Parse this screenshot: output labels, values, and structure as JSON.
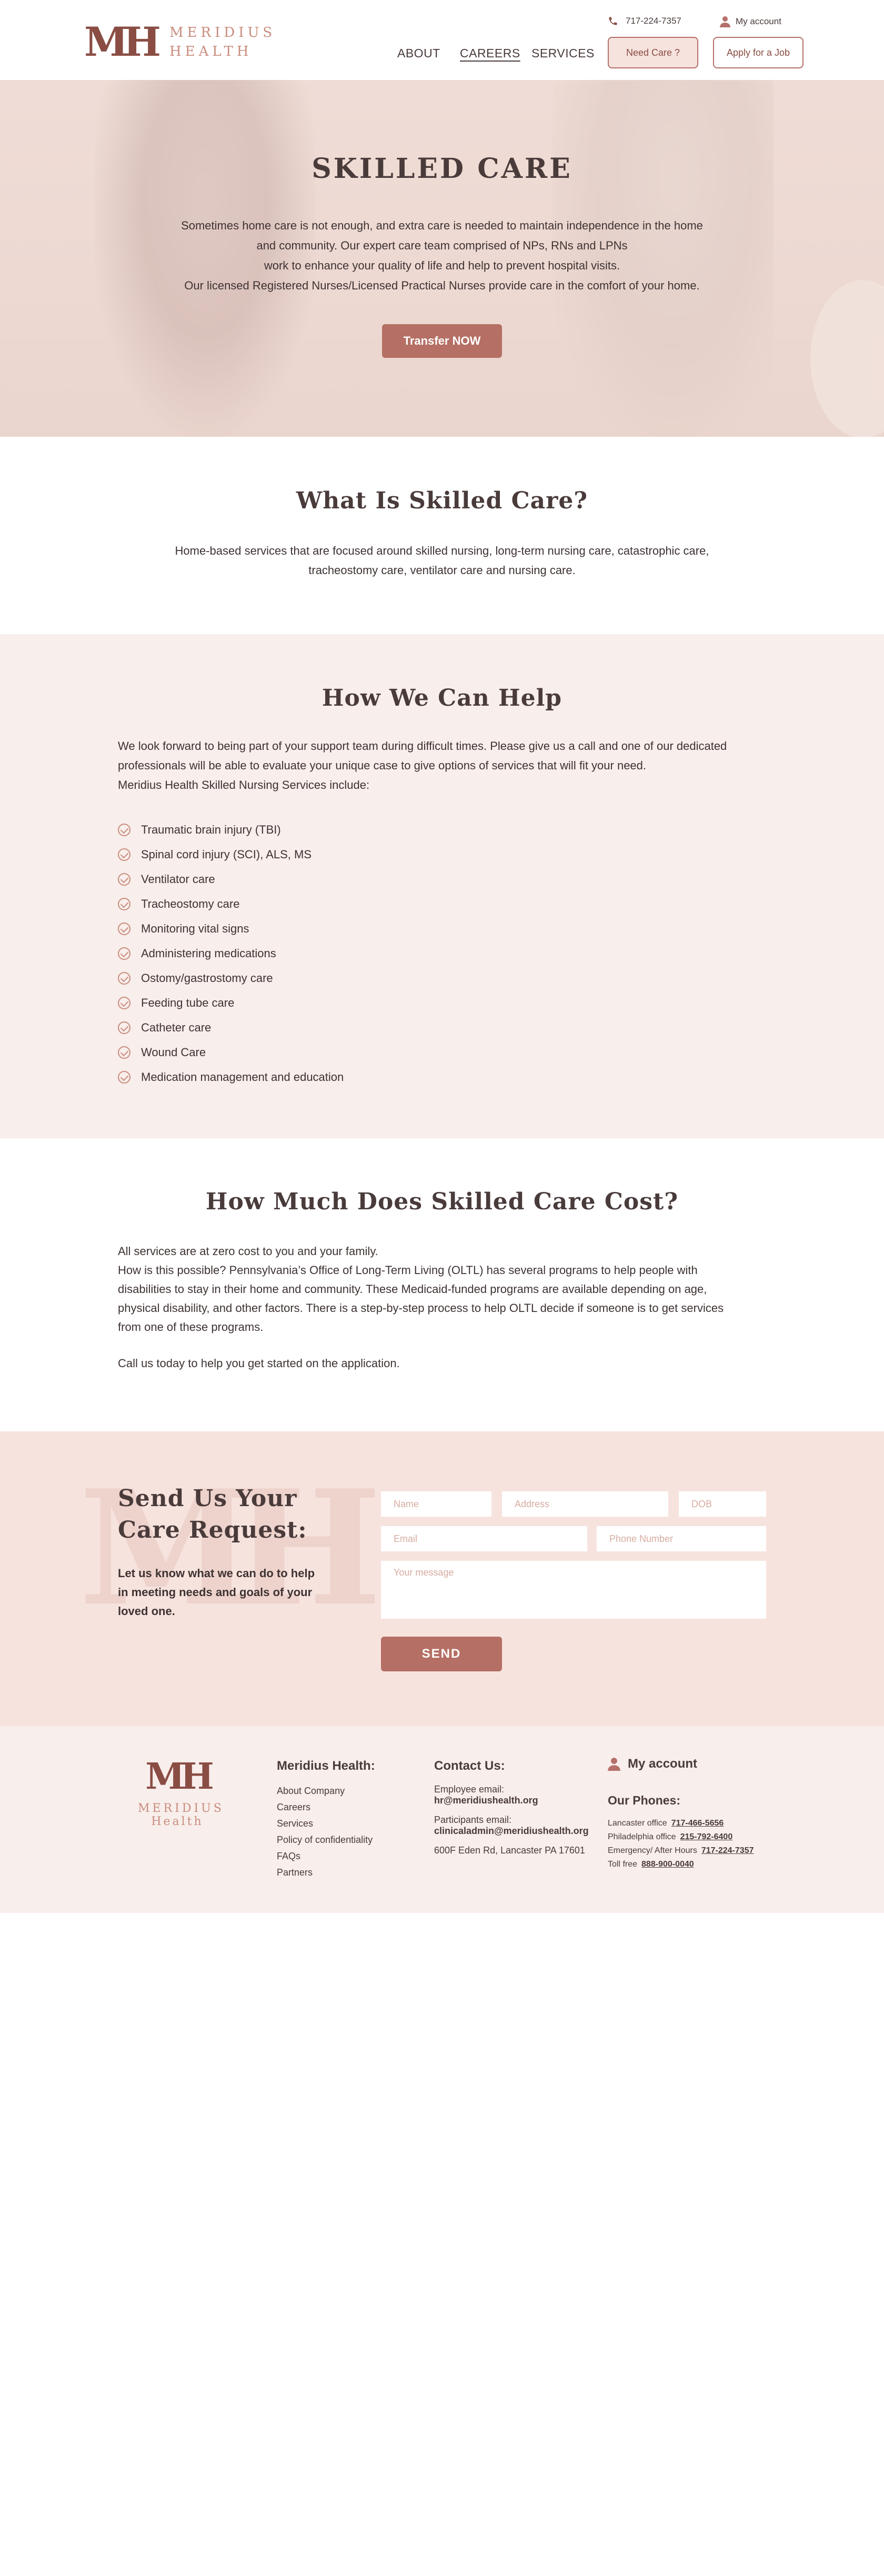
{
  "header": {
    "logo_mark": "MH",
    "logo_line1": "MERIDIUS",
    "logo_line2": "HEALTH",
    "phone": "717-224-7357",
    "account": "My account",
    "nav": [
      "ABOUT",
      "CAREERS",
      "SERVICES"
    ],
    "need_care": "Need Care ?",
    "apply_job": "Apply for a Job"
  },
  "hero": {
    "title": "SKILLED CARE",
    "lines": [
      "Sometimes home care is not enough, and extra care is needed to maintain independence in the home",
      "and community. Our expert care team comprised of NPs, RNs and LPNs",
      "work to enhance your quality of life and help to prevent hospital visits.",
      "Our licensed Registered Nurses/Licensed Practical Nurses provide care in the comfort of your home."
    ],
    "button": "Transfer NOW"
  },
  "what_is": {
    "title": "What Is Skilled Care?",
    "text": "Home-based services that are focused around skilled nursing, long-term nursing care, catastrophic care, tracheostomy care, ventilator care and nursing care."
  },
  "help": {
    "title": "How We Can Help",
    "intro": "We look forward to being part of your support team during difficult times. Please give us a call and one of our dedicated professionals will be able to evaluate your unique case to give options of services that will fit your need.",
    "services_intro": "Meridius Health Skilled Nursing Services include:",
    "items": [
      "Traumatic brain injury (TBI)",
      "Spinal cord injury (SCI), ALS, MS",
      "Ventilator care",
      "Tracheostomy care",
      "Monitoring vital signs",
      "Administering medications",
      "Ostomy/gastrostomy care",
      "Feeding tube care",
      "Catheter care",
      "Wound Care",
      "Medication management and education"
    ]
  },
  "cost": {
    "title": "How Much Does Skilled Care Cost?",
    "line1": "All services are at zero cost to you and your family.",
    "line2": "How is this possible? Pennsylvania’s Office of Long-Term Living (OLTL) has several programs to help people with disabilities to stay in their home and community. These Medicaid-funded programs are available depending on age, physical disability, and other factors.  There is a step-by-step process to help OLTL decide if someone is to get services from one of these programs.",
    "cta": "Call us today to help you get started on the application."
  },
  "request": {
    "watermark": "MH",
    "title_line1": "Send Us Your",
    "title_line2": "Care Request:",
    "subtitle": "Let us know what we can do to help in meeting needs and goals of your loved one.",
    "placeholders": {
      "name": "Name",
      "address": "Address",
      "dob": "DOB",
      "email": "Email",
      "phone": "Phone Number",
      "message": "Your message"
    },
    "send": "SEND"
  },
  "footer": {
    "logo_mark": "MH",
    "logo_line1": "MERIDIUS",
    "logo_line2": "Health",
    "col1_title": "Meridius Health:",
    "col1_links": [
      "About Company",
      "Careers",
      "Services",
      "Policy of confidentiality",
      "FAQs",
      "Partners"
    ],
    "contact_title": "Contact Us:",
    "employee_label": "Employee email:",
    "employee_email": "hr@meridiushealth.org",
    "participants_label": "Participants email:",
    "participants_email": "clinicaladmin@meridiushealth.org",
    "address": "600F Eden Rd, Lancaster PA 17601",
    "account": "My account",
    "phones_title": "Our Phones:",
    "phones": [
      {
        "label": "Lancaster office",
        "number": "717-466-5656"
      },
      {
        "label": "Philadelphia office",
        "number": "215-792-6400"
      },
      {
        "label": "Emergency/ After Hours",
        "number": "717-224-7357"
      },
      {
        "label": "Toll free",
        "number": "888-900-0040"
      }
    ]
  },
  "colors": {
    "brand": "#8a4d44",
    "accent": "#b56f64",
    "light_pink": "#f7e3de",
    "section_bg": "#f8eeeb"
  }
}
